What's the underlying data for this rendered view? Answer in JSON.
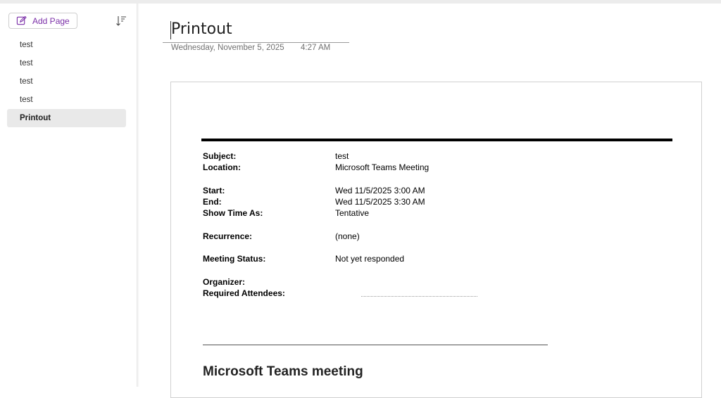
{
  "sidebar": {
    "add_page_label": "Add Page",
    "pages": [
      {
        "label": "test"
      },
      {
        "label": "test"
      },
      {
        "label": "test"
      },
      {
        "label": "test"
      },
      {
        "label": "Printout"
      }
    ]
  },
  "page": {
    "title": "Printout",
    "date": "Wednesday, November 5, 2025",
    "time": "4:27 AM"
  },
  "printout": {
    "subject_label": "Subject:",
    "subject_value": "test",
    "location_label": "Location:",
    "location_value": "Microsoft Teams Meeting",
    "start_label": "Start:",
    "start_value": "Wed 11/5/2025 3:00 AM",
    "end_label": "End:",
    "end_value": "Wed 11/5/2025 3:30 AM",
    "show_time_as_label": "Show Time As:",
    "show_time_as_value": "Tentative",
    "recurrence_label": "Recurrence:",
    "recurrence_value": "(none)",
    "meeting_status_label": "Meeting Status:",
    "meeting_status_value": "Not yet responded",
    "organizer_label": "Organizer:",
    "required_attendees_label": "Required Attendees:",
    "teams_heading": "Microsoft Teams meeting"
  },
  "colors": {
    "accent": "#7b2fa8",
    "selected_bg": "#e9e9e9"
  }
}
